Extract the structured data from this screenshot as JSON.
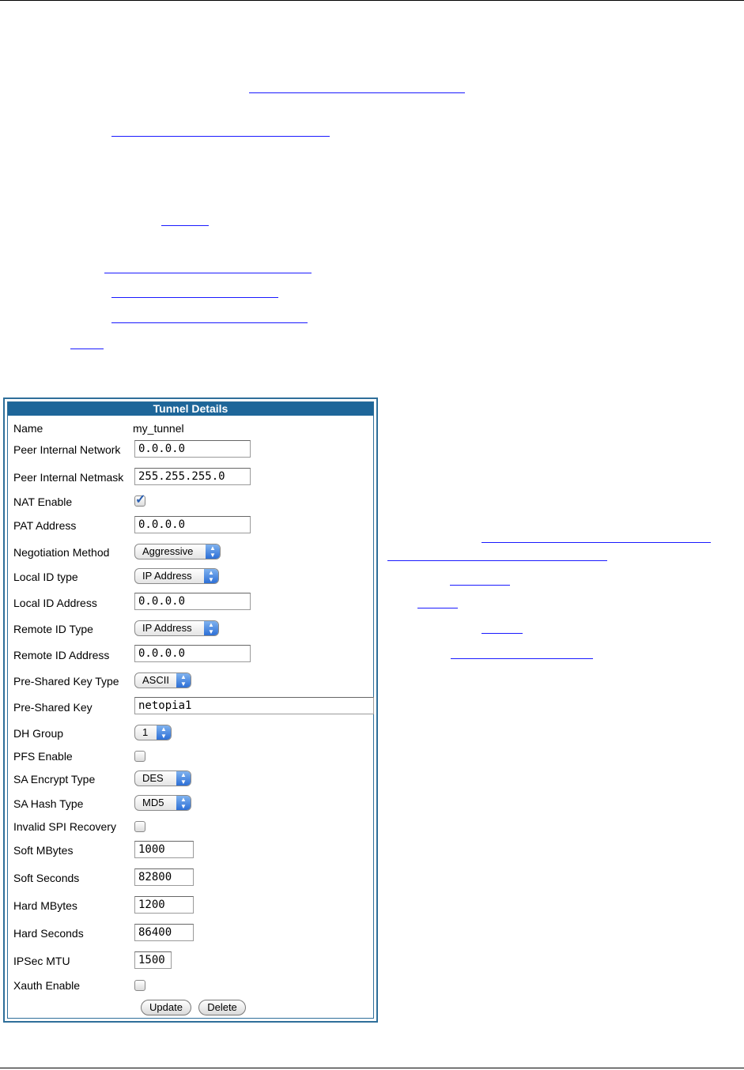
{
  "panel": {
    "title": "Tunnel Details",
    "name_label": "Name",
    "name_value": "my_tunnel",
    "peer_network_label": "Peer Internal Network",
    "peer_network_value": "0.0.0.0",
    "peer_netmask_label": "Peer Internal Netmask",
    "peer_netmask_value": "255.255.255.0",
    "nat_enable_label": "NAT Enable",
    "nat_enable_checked": true,
    "pat_address_label": "PAT Address",
    "pat_address_value": "0.0.0.0",
    "negotiation_label": "Negotiation Method",
    "negotiation_value": "Aggressive",
    "local_id_type_label": "Local ID type",
    "local_id_type_value": "IP Address",
    "local_id_address_label": "Local ID Address",
    "local_id_address_value": "0.0.0.0",
    "remote_id_type_label": "Remote ID Type",
    "remote_id_type_value": "IP Address",
    "remote_id_address_label": "Remote ID Address",
    "remote_id_address_value": "0.0.0.0",
    "psk_type_label": "Pre-Shared Key Type",
    "psk_type_value": "ASCII",
    "psk_label": "Pre-Shared Key",
    "psk_value": "netopia1",
    "dh_group_label": "DH Group",
    "dh_group_value": "1",
    "pfs_label": "PFS Enable",
    "pfs_checked": false,
    "sa_encrypt_label": "SA Encrypt Type",
    "sa_encrypt_value": "DES",
    "sa_hash_label": "SA Hash Type",
    "sa_hash_value": "MD5",
    "invalid_spi_label": "Invalid SPI Recovery",
    "invalid_spi_checked": false,
    "soft_mbytes_label": "Soft MBytes",
    "soft_mbytes_value": "1000",
    "soft_seconds_label": "Soft Seconds",
    "soft_seconds_value": "82800",
    "hard_mbytes_label": "Hard MBytes",
    "hard_mbytes_value": "1200",
    "hard_seconds_label": "Hard Seconds",
    "hard_seconds_value": "86400",
    "ipsec_mtu_label": "IPSec MTU",
    "ipsec_mtu_value": "1500",
    "xauth_label": "Xauth Enable",
    "xauth_checked": false,
    "update_button": "Update",
    "delete_button": "Delete"
  },
  "colors": {
    "title_bar": "#1e6699",
    "link": "#1a1aff",
    "select_arrow": "#2d6fd6"
  }
}
